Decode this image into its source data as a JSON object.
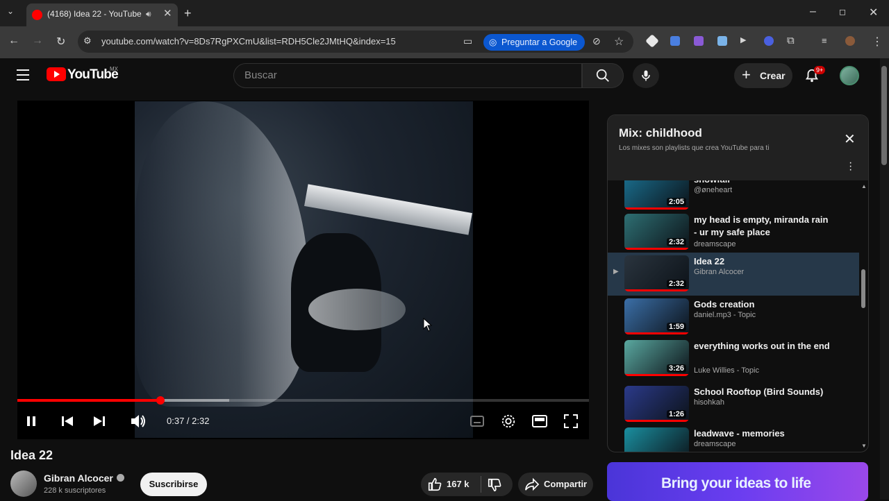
{
  "browser": {
    "tab_title": "(4168) Idea 22 - YouTube",
    "url": "youtube.com/watch?v=8Ds7RgPXCmU&list=RDH5Cle2JMtHQ&index=15",
    "ask_google": "Preguntar a Google"
  },
  "header": {
    "logo": "YouTube",
    "country": "MX",
    "search_placeholder": "Buscar",
    "create_label": "Crear",
    "notifications_badge": "9+"
  },
  "player": {
    "time": "0:37 / 2:32",
    "progress_fraction": 0.25,
    "buffer_fraction": 0.37
  },
  "video": {
    "title": "Idea 22",
    "channel": "Gibran Alcocer",
    "subscribers": "228 k suscriptores",
    "subscribe_label": "Suscribirse",
    "likes": "167 k",
    "share_label": "Compartir"
  },
  "playlist": {
    "title": "Mix: childhood",
    "subtitle": "Los mixes son playlists que crea YouTube para ti",
    "items": [
      {
        "title": "snowfall",
        "channel": "@øneheart",
        "duration": "2:05",
        "color": "#1a6f8f"
      },
      {
        "title": "my head is empty, miranda rain - ur my safe place",
        "channel": "dreamscape",
        "duration": "2:32",
        "color": "#2e6f73"
      },
      {
        "title": "Idea 22",
        "channel": "Gibran Alcocer",
        "duration": "2:32",
        "color": "#2a343e",
        "active": true
      },
      {
        "title": "Gods creation",
        "channel": "daniel.mp3 - Topic",
        "duration": "1:59",
        "color": "#3b6fa8"
      },
      {
        "title": "everything works out in the end",
        "channel": "Luke Willies - Topic",
        "duration": "3:26",
        "color": "#5aa8a0"
      },
      {
        "title": "School Rooftop (Bird Sounds)",
        "channel": "hisohkah",
        "duration": "1:26",
        "color": "#2b3a8a"
      },
      {
        "title": "leadwave - memories",
        "channel": "dreamscape",
        "duration": "",
        "color": "#1a8fa0"
      }
    ]
  },
  "ad": {
    "text": "Bring your ideas to life"
  }
}
